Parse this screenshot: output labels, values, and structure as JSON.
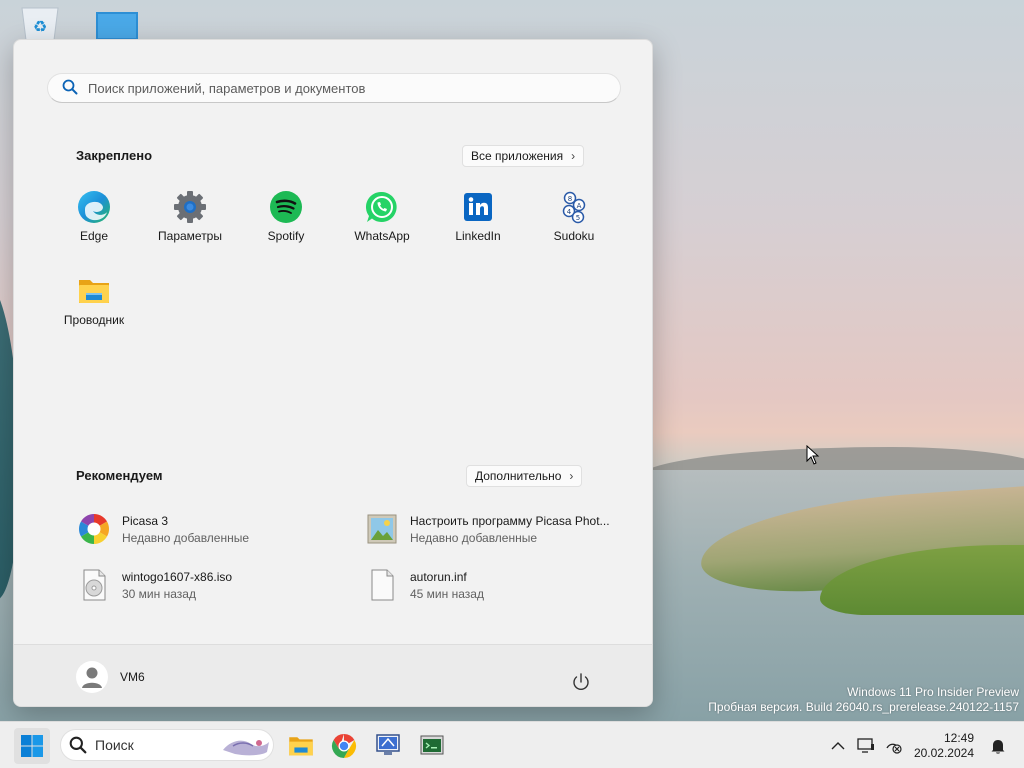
{
  "desktop": {
    "icons": [
      "recycle-bin-icon",
      "monitor-icon"
    ],
    "watermark": {
      "line1": "Windows 11 Pro Insider Preview",
      "line2": "Пробная версия. Build 26040.rs_prerelease.240122-1157"
    }
  },
  "start_menu": {
    "search": {
      "placeholder": "Поиск приложений, параметров и документов"
    },
    "pinned": {
      "title": "Закреплено",
      "all_apps_label": "Все приложения",
      "apps": [
        {
          "label": "Edge",
          "icon": "edge-icon"
        },
        {
          "label": "Параметры",
          "icon": "gear-icon"
        },
        {
          "label": "Spotify",
          "icon": "spotify-icon"
        },
        {
          "label": "WhatsApp",
          "icon": "whatsapp-icon"
        },
        {
          "label": "LinkedIn",
          "icon": "linkedin-icon"
        },
        {
          "label": "Sudoku",
          "icon": "sudoku-icon"
        },
        {
          "label": "Проводник",
          "icon": "folder-icon"
        }
      ]
    },
    "recommended": {
      "title": "Рекомендуем",
      "more_label": "Дополнительно",
      "items": [
        {
          "name": "Picasa 3",
          "time": "Недавно добавленные",
          "icon": "picasa-icon"
        },
        {
          "name": "Настроить программу Picasa Phot...",
          "time": "Недавно добавленные",
          "icon": "picture-icon"
        },
        {
          "name": "wintogo1607-x86.iso",
          "time": "30 мин назад",
          "icon": "disc-image-icon"
        },
        {
          "name": "autorun.inf",
          "time": "45 мин назад",
          "icon": "file-icon"
        }
      ]
    },
    "user": {
      "name": "VM6"
    }
  },
  "taskbar": {
    "search_label": "Поиск",
    "pinned_icons": [
      "file-explorer-icon",
      "chrome-icon",
      "app-monitor-icon",
      "terminal-app-icon"
    ],
    "clock": {
      "time": "12:49",
      "date": "20.02.2024"
    }
  },
  "colors": {
    "accent": "#0078d4",
    "menu_bg": "#f2f2f2",
    "taskbar_bg": "#eeeeee"
  }
}
